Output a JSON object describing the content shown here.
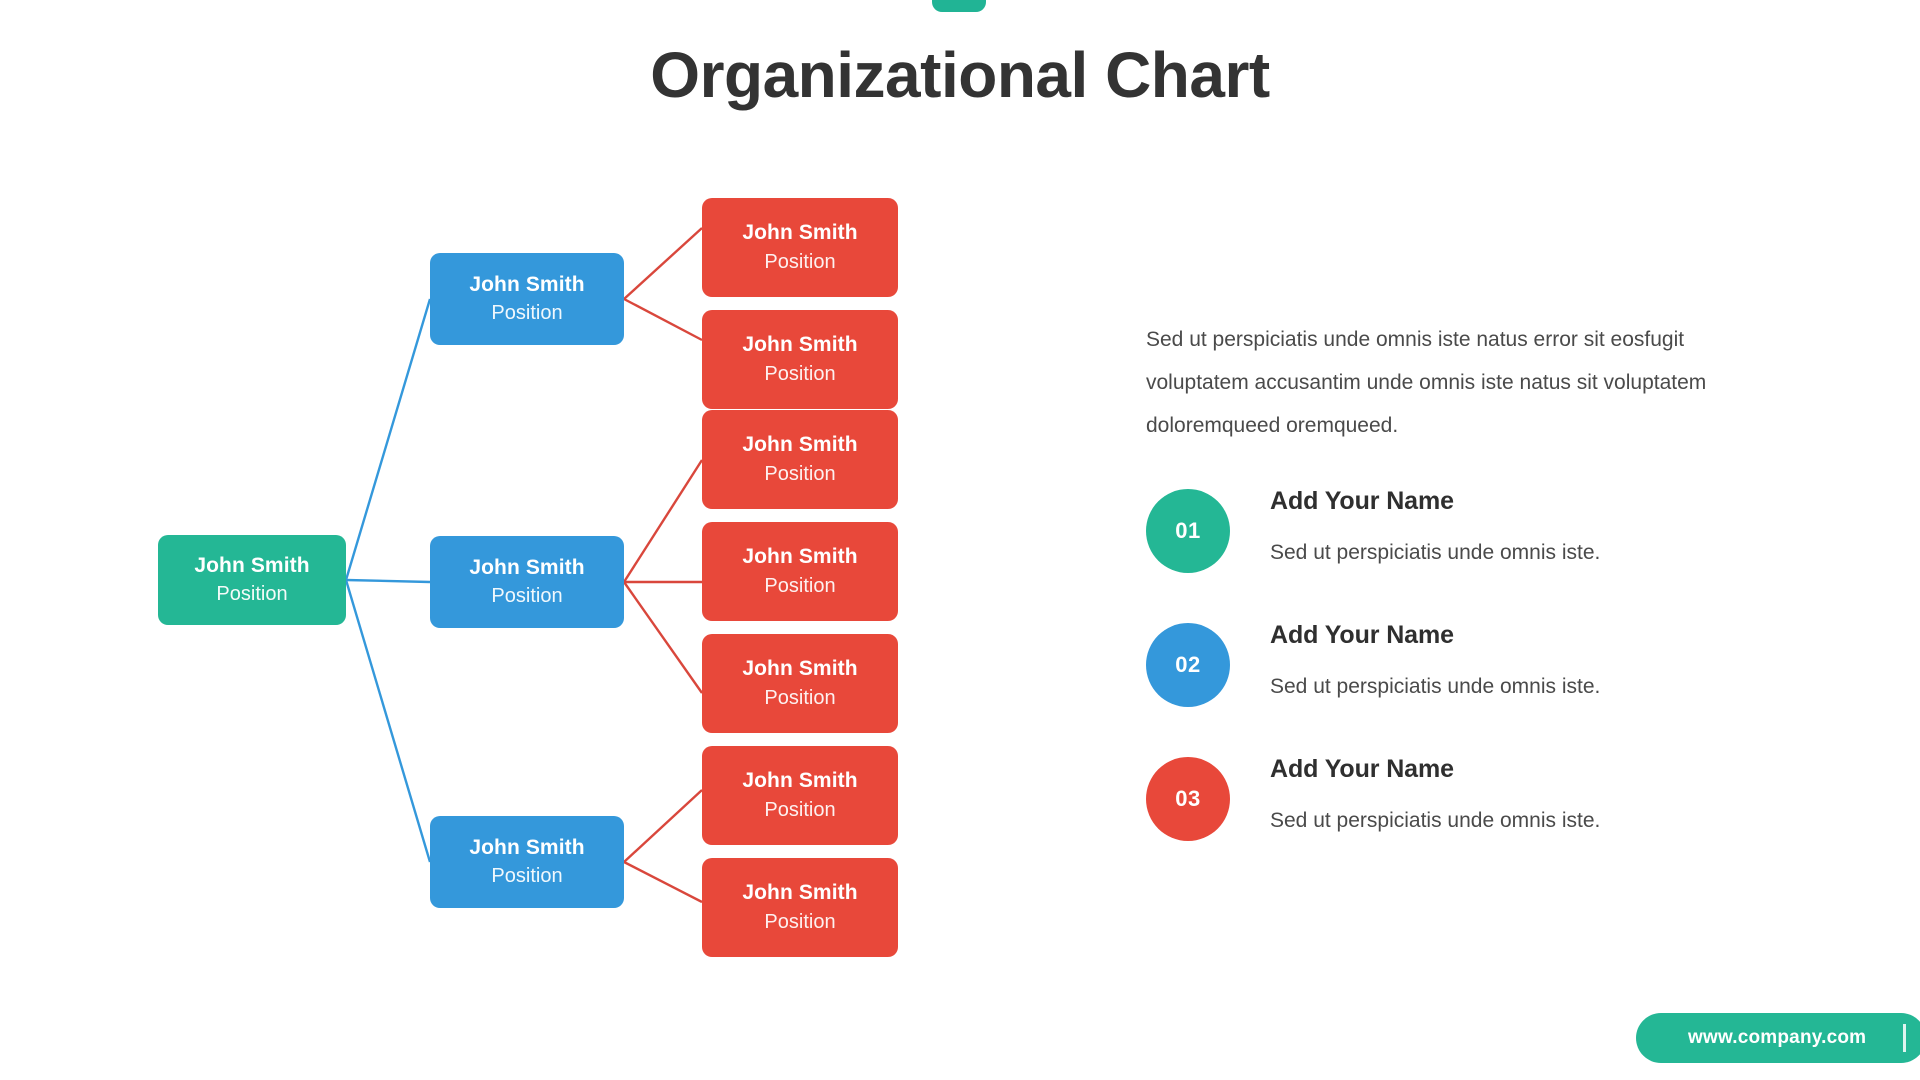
{
  "slide": {
    "title": "Organizational Chart",
    "accent_green": "#24b795",
    "accent_blue": "#3498db",
    "accent_red": "#e8483a",
    "title_color": "#333333",
    "background": "#ffffff"
  },
  "org_chart": {
    "root": {
      "name": "John Smith",
      "position": "Position",
      "color": "#24b795"
    },
    "branches": [
      {
        "manager": {
          "name": "John Smith",
          "position": "Position",
          "color": "#3498db"
        },
        "reports": [
          {
            "name": "John Smith",
            "position": "Position",
            "color": "#e8483a"
          },
          {
            "name": "John Smith",
            "position": "Position",
            "color": "#e8483a"
          }
        ]
      },
      {
        "manager": {
          "name": "John Smith",
          "position": "Position",
          "color": "#3498db"
        },
        "reports": [
          {
            "name": "John Smith",
            "position": "Position",
            "color": "#e8483a"
          },
          {
            "name": "John Smith",
            "position": "Position",
            "color": "#e8483a"
          },
          {
            "name": "John Smith",
            "position": "Position",
            "color": "#e8483a"
          }
        ]
      },
      {
        "manager": {
          "name": "John Smith",
          "position": "Position",
          "color": "#3498db"
        },
        "reports": [
          {
            "name": "John Smith",
            "position": "Position",
            "color": "#e8483a"
          },
          {
            "name": "John Smith",
            "position": "Position",
            "color": "#e8483a"
          }
        ]
      }
    ]
  },
  "right_panel": {
    "intro": "Sed ut perspiciatis unde omnis iste natus error sit eosfugit voluptatem accusantim unde omnis iste natus sit voluptatem doloremqueed oremqueed.",
    "features": [
      {
        "number": "01",
        "title": "Add Your Name",
        "desc": "Sed ut perspiciatis unde omnis iste.",
        "color": "#24b795"
      },
      {
        "number": "02",
        "title": "Add Your Name",
        "desc": "Sed ut perspiciatis unde omnis iste.",
        "color": "#3498db"
      },
      {
        "number": "03",
        "title": "Add Your Name",
        "desc": "Sed ut perspiciatis unde omnis iste.",
        "color": "#e8483a"
      }
    ]
  },
  "footer": {
    "url": "www.company.com"
  }
}
